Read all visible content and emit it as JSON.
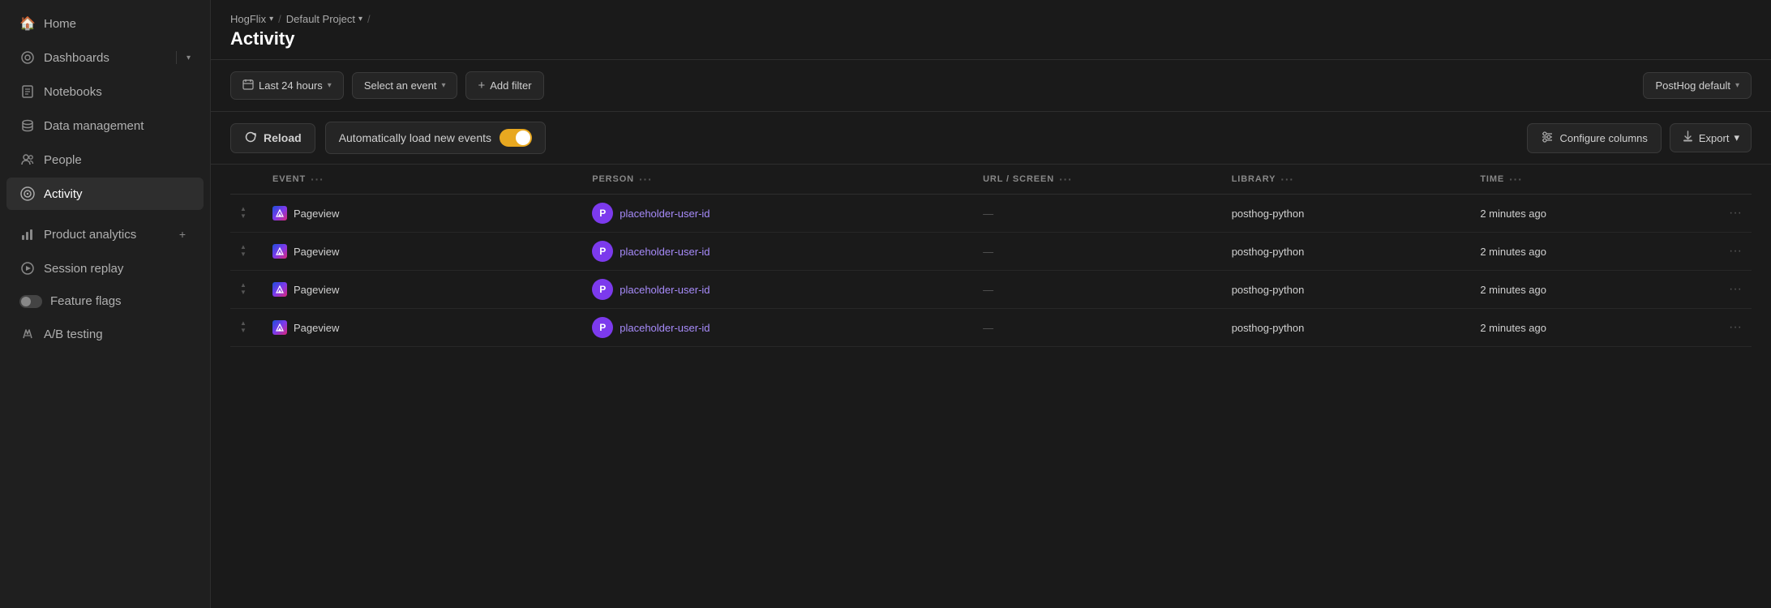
{
  "sidebar": {
    "items": [
      {
        "id": "home",
        "label": "Home",
        "icon": "🏠",
        "active": false
      },
      {
        "id": "dashboards",
        "label": "Dashboards",
        "icon": "⊙",
        "active": false,
        "expandable": true
      },
      {
        "id": "notebooks",
        "label": "Notebooks",
        "icon": "📋",
        "active": false
      },
      {
        "id": "data-management",
        "label": "Data management",
        "icon": "🗄",
        "active": false
      },
      {
        "id": "people",
        "label": "People",
        "icon": "👥",
        "active": false
      },
      {
        "id": "activity",
        "label": "Activity",
        "icon": "((·))",
        "active": true
      },
      {
        "id": "product-analytics",
        "label": "Product analytics",
        "icon": "📊",
        "active": false,
        "hasPlus": true
      },
      {
        "id": "session-replay",
        "label": "Session replay",
        "icon": "▶",
        "active": false
      },
      {
        "id": "feature-flags",
        "label": "Feature flags",
        "icon": "toggle",
        "active": false
      },
      {
        "id": "ab-testing",
        "label": "A/B testing",
        "icon": "⚗",
        "active": false
      }
    ]
  },
  "breadcrumb": {
    "items": [
      {
        "label": "HogFlix",
        "hasChevron": true
      },
      {
        "label": "Default Project",
        "hasChevron": true
      }
    ]
  },
  "page": {
    "title": "Activity"
  },
  "toolbar": {
    "time_filter": {
      "label": "Last 24 hours",
      "icon": "📅"
    },
    "event_filter": {
      "label": "Select an event"
    },
    "add_filter": {
      "label": "Add filter"
    },
    "posthog_default": {
      "label": "PostHog default"
    }
  },
  "toolbar2": {
    "reload_label": "Reload",
    "auto_load_label": "Automatically load new events",
    "configure_label": "Configure columns",
    "export_label": "Export"
  },
  "table": {
    "columns": [
      {
        "id": "event",
        "label": "EVENT"
      },
      {
        "id": "person",
        "label": "PERSON"
      },
      {
        "id": "url_screen",
        "label": "URL / SCREEN"
      },
      {
        "id": "library",
        "label": "LIBRARY"
      },
      {
        "id": "time",
        "label": "TIME"
      }
    ],
    "rows": [
      {
        "event": "Pageview",
        "person": "placeholder-user-id",
        "person_initial": "P",
        "url_screen": "—",
        "library": "posthog-python",
        "time": "2 minutes ago"
      },
      {
        "event": "Pageview",
        "person": "placeholder-user-id",
        "person_initial": "P",
        "url_screen": "—",
        "library": "posthog-python",
        "time": "2 minutes ago"
      },
      {
        "event": "Pageview",
        "person": "placeholder-user-id",
        "person_initial": "P",
        "url_screen": "—",
        "library": "posthog-python",
        "time": "2 minutes ago"
      },
      {
        "event": "Pageview",
        "person": "placeholder-user-id",
        "person_initial": "P",
        "url_screen": "—",
        "library": "posthog-python",
        "time": "2 minutes ago"
      }
    ]
  }
}
